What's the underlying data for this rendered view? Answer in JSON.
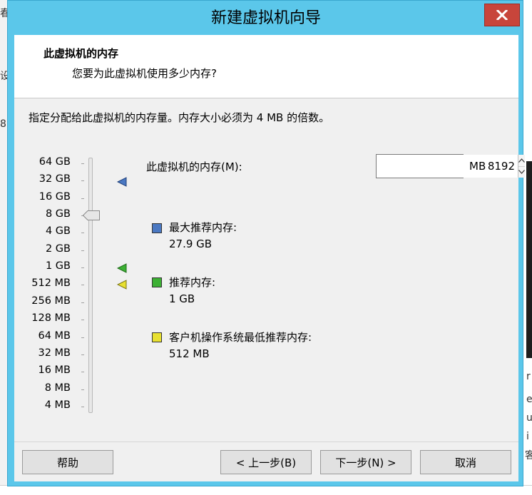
{
  "background": {
    "left_chars": [
      "春",
      "设",
      "8"
    ],
    "right_chars": [
      "r",
      "e",
      "u",
      "i",
      "客"
    ]
  },
  "window": {
    "title": "新建虚拟机向导",
    "header": {
      "title": "此虚拟机的内存",
      "subtitle": "您要为此虚拟机使用多少内存?"
    },
    "instruction": "指定分配给此虚拟机的内存量。内存大小必须为 4 MB 的倍数。"
  },
  "scale": {
    "labels": [
      "64 GB",
      "32 GB",
      "16 GB",
      "8 GB",
      "4 GB",
      "2 GB",
      "1 GB",
      "512 MB",
      "256 MB",
      "128 MB",
      "64 MB",
      "32 MB",
      "16 MB",
      "8 MB",
      "4 MB"
    ],
    "selected": "8 GB"
  },
  "memory": {
    "label": "此虚拟机的内存(M):",
    "value": "8192",
    "unit": "MB"
  },
  "legend": {
    "max": {
      "label": "最大推荐内存:",
      "value": "27.9 GB",
      "color": "#4a78c2"
    },
    "recommended": {
      "label": "推荐内存:",
      "value": "1 GB",
      "color": "#3cb034"
    },
    "guest_min": {
      "label": "客户机操作系统最低推荐内存:",
      "value": "512 MB",
      "color": "#e8e030"
    }
  },
  "buttons": {
    "help": "帮助",
    "back": "< 上一步(B)",
    "next": "下一步(N) >",
    "cancel": "取消"
  },
  "colors": {
    "frame": "#5bc7ea",
    "close": "#c8453b",
    "client": "#f0f0f0"
  }
}
